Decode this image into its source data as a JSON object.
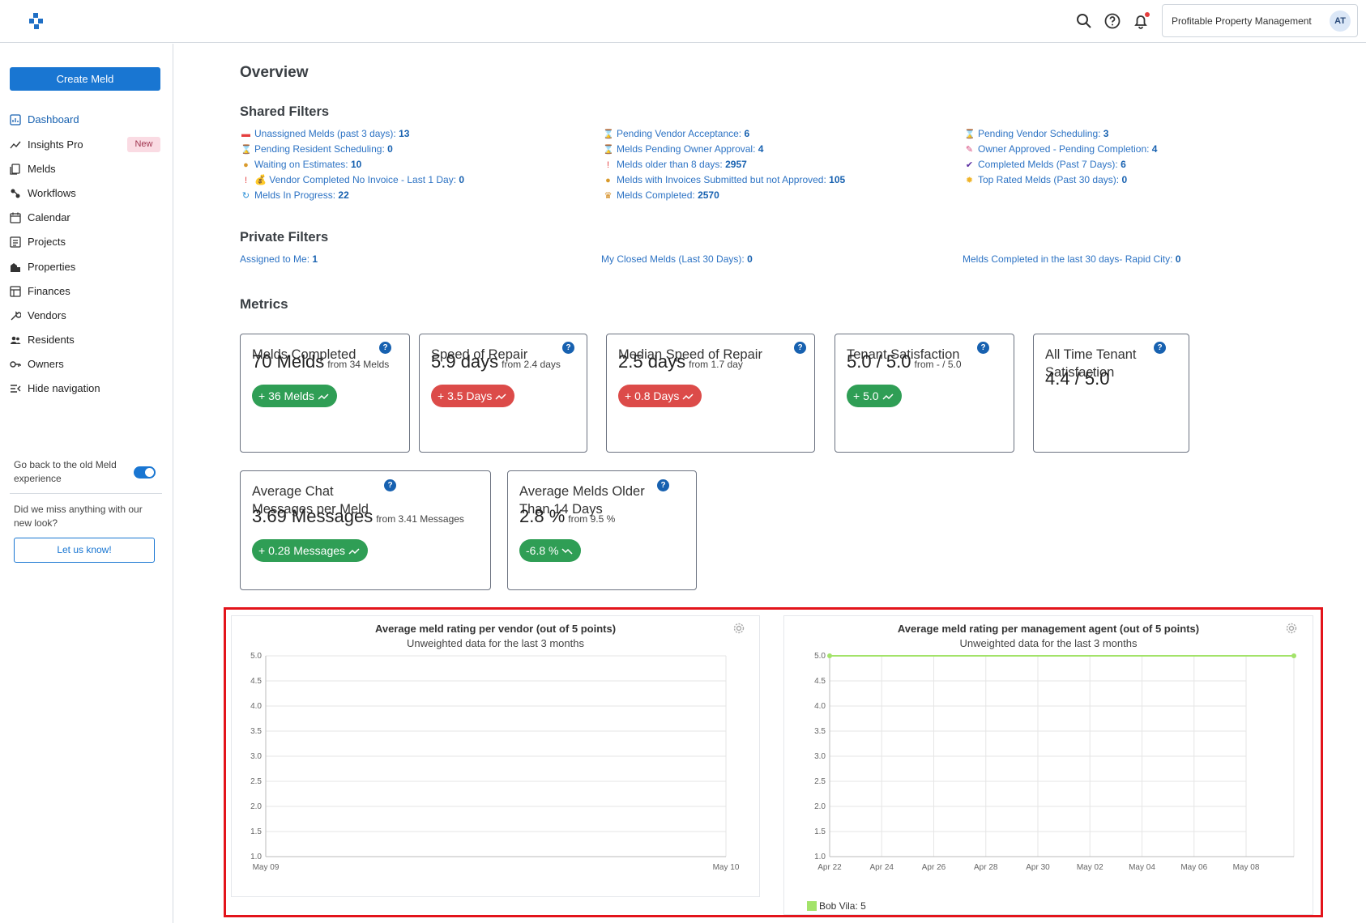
{
  "header": {
    "org_name": "Profitable Property Management",
    "avatar_initials": "AT",
    "brand_color": "#1976d2"
  },
  "sidebar": {
    "create_label": "Create Meld",
    "items": [
      {
        "label": "Dashboard",
        "icon": "dashboard-icon",
        "active": true
      },
      {
        "label": "Insights Pro",
        "icon": "insights-icon",
        "badge": "New"
      },
      {
        "label": "Melds",
        "icon": "melds-icon"
      },
      {
        "label": "Workflows",
        "icon": "workflows-icon"
      },
      {
        "label": "Calendar",
        "icon": "calendar-icon"
      },
      {
        "label": "Projects",
        "icon": "projects-icon"
      },
      {
        "label": "Properties",
        "icon": "properties-icon"
      },
      {
        "label": "Finances",
        "icon": "finances-icon"
      },
      {
        "label": "Vendors",
        "icon": "vendors-icon"
      },
      {
        "label": "Residents",
        "icon": "residents-icon"
      },
      {
        "label": "Owners",
        "icon": "owners-icon"
      },
      {
        "label": "Hide navigation",
        "icon": "hide-nav-icon"
      }
    ],
    "toggle_text": "Go back to the old Meld experience",
    "toggle_on": true,
    "feedback_text": "Did we miss anything with our new look?",
    "feedback_button": "Let us know!"
  },
  "overview": {
    "title": "Overview",
    "shared_title": "Shared Filters",
    "shared_filters": [
      [
        {
          "icon": "red-envelope-icon",
          "glyph": "▬",
          "color": "#e53e3e",
          "label": "Unassigned Melds (past 3 days):",
          "count": "13"
        },
        {
          "icon": "hourglass-icon",
          "glyph": "⌛",
          "color": "#c58a2a",
          "label": "Pending Resident Scheduling:",
          "count": "0"
        },
        {
          "icon": "money-bag-icon",
          "glyph": "●",
          "color": "#d99a2b",
          "label": "Waiting on Estimates:",
          "count": "10"
        },
        {
          "icon": "exclamation-money-icon",
          "glyph": "!",
          "color": "#e53e3e",
          "label": "💰 Vendor Completed No Invoice - Last 1 Day:",
          "count": "0"
        },
        {
          "icon": "in-progress-icon",
          "glyph": "↻",
          "color": "#2a8fd8",
          "label": "Melds In Progress:",
          "count": "22"
        }
      ],
      [
        {
          "icon": "hourglass-icon",
          "glyph": "⌛",
          "color": "#c58a2a",
          "label": "Pending Vendor Acceptance:",
          "count": "6"
        },
        {
          "icon": "hourglass-icon",
          "glyph": "⌛",
          "color": "#c58a2a",
          "label": "Melds Pending Owner Approval:",
          "count": "4"
        },
        {
          "icon": "exclamation-icon",
          "glyph": "!",
          "color": "#e53e3e",
          "label": "Melds older than 8 days:",
          "count": "2957"
        },
        {
          "icon": "money-bag-icon",
          "glyph": "●",
          "color": "#d99a2b",
          "label": "Melds with Invoices Submitted but not Approved:",
          "count": "105"
        },
        {
          "icon": "trophy-icon",
          "glyph": "♛",
          "color": "#d48b1f",
          "label": "Melds Completed:",
          "count": "2570"
        }
      ],
      [
        {
          "icon": "hourglass-icon",
          "glyph": "⌛",
          "color": "#c58a2a",
          "label": "Pending Vendor Scheduling:",
          "count": "3"
        },
        {
          "icon": "syringe-icon",
          "glyph": "✎",
          "color": "#d6457a",
          "label": "Owner Approved - Pending Completion:",
          "count": "4"
        },
        {
          "icon": "check-icon",
          "glyph": "✔",
          "color": "#5a2ca0",
          "label": "Completed Melds (Past 7 Days):",
          "count": "6"
        },
        {
          "icon": "sun-icon",
          "glyph": "✹",
          "color": "#f0b429",
          "label": "Top Rated Melds (Past 30 days):",
          "count": "0"
        }
      ]
    ],
    "private_title": "Private Filters",
    "private_filters": [
      {
        "label": "Assigned to Me:",
        "count": "1"
      },
      {
        "label": "My Closed Melds (Last 30 Days):",
        "count": "0"
      },
      {
        "label": "Melds Completed in the last 30 days- Rapid City:",
        "count": "0"
      }
    ]
  },
  "metrics": {
    "title": "Metrics",
    "cards": [
      {
        "title": "Melds Completed",
        "value": "70 Melds",
        "from": "from 34 Melds",
        "change": "+ 36 Melds",
        "trend": "up",
        "color": "green"
      },
      {
        "title": "Speed of Repair",
        "value": "5.9 days",
        "from": "from 2.4 days",
        "change": "+ 3.5 Days",
        "trend": "up",
        "color": "red"
      },
      {
        "title": "Median Speed of Repair",
        "value": "2.5 days",
        "from": "from 1.7 day",
        "change": "+ 0.8 Days",
        "trend": "up",
        "color": "red"
      },
      {
        "title": "Tenant Satisfaction",
        "value": "5.0 / 5.0",
        "from": "from - / 5.0",
        "change": "+ 5.0",
        "trend": "up",
        "color": "green"
      },
      {
        "title": "All Time Tenant Satisfaction",
        "value": "4.4 / 5.0",
        "from": "",
        "change": "",
        "trend": "",
        "color": ""
      },
      {
        "title": "Average Chat Messages per Meld",
        "value": "3.69 Messages",
        "from": "from 3.41 Messages",
        "change": "+ 0.28 Messages",
        "trend": "up",
        "color": "green"
      },
      {
        "title": "Average Melds Older Than 14 Days",
        "value": "2.8 %",
        "from": "from 9.5 %",
        "change": "-6.8 %",
        "trend": "down",
        "color": "green"
      }
    ]
  },
  "chart_data": [
    {
      "type": "line",
      "title": "Average meld rating per vendor (out of 5 points)",
      "subtitle": "Unweighted data for the last 3 months",
      "x": [
        "May 09",
        "May 10"
      ],
      "yticks": [
        "5.0",
        "4.5",
        "4.0",
        "3.5",
        "3.0",
        "2.5",
        "2.0",
        "1.5",
        "1.0"
      ],
      "ylim": [
        1.0,
        5.0
      ],
      "series": [],
      "grid": true
    },
    {
      "type": "line",
      "title": "Average meld rating per management agent (out of 5 points)",
      "subtitle": "Unweighted data for the last 3 months",
      "x": [
        "Apr 22",
        "Apr 24",
        "Apr 26",
        "Apr 28",
        "Apr 30",
        "May 02",
        "May 04",
        "May 06",
        "May 08"
      ],
      "yticks": [
        "5.0",
        "4.5",
        "4.0",
        "3.5",
        "3.0",
        "2.5",
        "2.0",
        "1.5",
        "1.0"
      ],
      "ylim": [
        1.0,
        5.0
      ],
      "series": [
        {
          "name": "Bob Vila",
          "legend_label": "Bob Vila: 5",
          "color": "#a3e36a",
          "values": [
            5.0,
            5.0
          ]
        }
      ],
      "grid": true,
      "legend": "bottom-left"
    }
  ]
}
